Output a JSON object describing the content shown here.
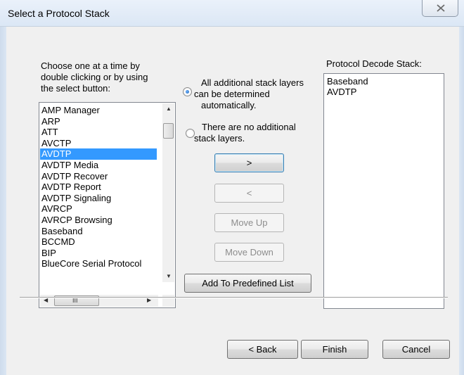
{
  "window": {
    "title": "Select a Protocol Stack",
    "close_icon": "close-icon"
  },
  "instructions": {
    "line1": "Choose one at a time by",
    "line2": "double clicking or by using",
    "line3": "the select button:"
  },
  "protocol_list": {
    "items": [
      "AMP Manager",
      "ARP",
      "ATT",
      "AVCTP",
      "AVDTP",
      "AVDTP Media",
      "AVDTP Recover",
      "AVDTP Report",
      "AVDTP Signaling",
      "AVRCP",
      "AVRCP Browsing",
      "Baseband",
      "BCCMD",
      "BIP",
      "BlueCore Serial Protocol"
    ],
    "selected": "AVDTP",
    "hscroll_grip": "III"
  },
  "options": {
    "auto": {
      "line1": "All additional stack layers",
      "line2": "can be determined",
      "line3": "automatically.",
      "checked": true
    },
    "none": {
      "line1": "There are no additional",
      "line2": "stack layers.",
      "checked": false
    }
  },
  "buttons": {
    "add": ">",
    "remove": "<",
    "move_up": "Move Up",
    "move_down": "Move Down",
    "add_predefined": "Add To Predefined List",
    "back": "< Back",
    "finish": "Finish",
    "cancel": "Cancel"
  },
  "decode_stack": {
    "label": "Protocol Decode Stack:",
    "items": [
      "Baseband",
      "AVDTP"
    ]
  },
  "colors": {
    "selection": "#3399ff",
    "dialog_bg": "#f0f0f0"
  }
}
